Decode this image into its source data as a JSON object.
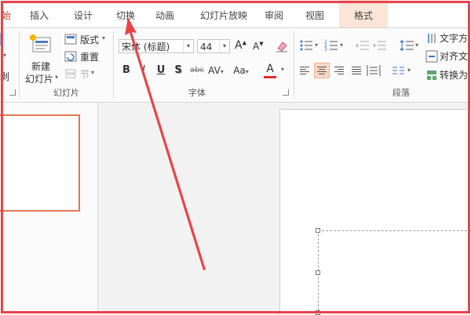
{
  "tabs": [
    {
      "label": "始"
    },
    {
      "label": "插入"
    },
    {
      "label": "设计"
    },
    {
      "label": "切换"
    },
    {
      "label": "动画"
    },
    {
      "label": "幻灯片放映"
    },
    {
      "label": "审阅"
    },
    {
      "label": "视图"
    },
    {
      "label": "格式"
    }
  ],
  "slides_group": {
    "label": "幻灯片",
    "new_slide_line1": "新建",
    "new_slide_line2": "幻灯片",
    "layout": "版式",
    "reset": "重置",
    "section": "节",
    "left_partial": "剥"
  },
  "font_group": {
    "label": "字体",
    "font_name": "宋体 (标题)",
    "font_size": "44",
    "grow": "A",
    "shrink": "A",
    "bold": "B",
    "italic": "I",
    "underline": "U",
    "shadow": "S",
    "strike": "abc",
    "spacing": "AV",
    "change_case": "Aa",
    "font_color": "A"
  },
  "para_group": {
    "label": "段落",
    "text_direction": "文字方",
    "align_text": "对齐文",
    "convert": "转换为"
  },
  "colors": {
    "accent": "#d24726",
    "annotation": "#e9434a",
    "selected_align_bg": "#fbd9c6",
    "format_tab_bg": "#fbe5d6"
  }
}
